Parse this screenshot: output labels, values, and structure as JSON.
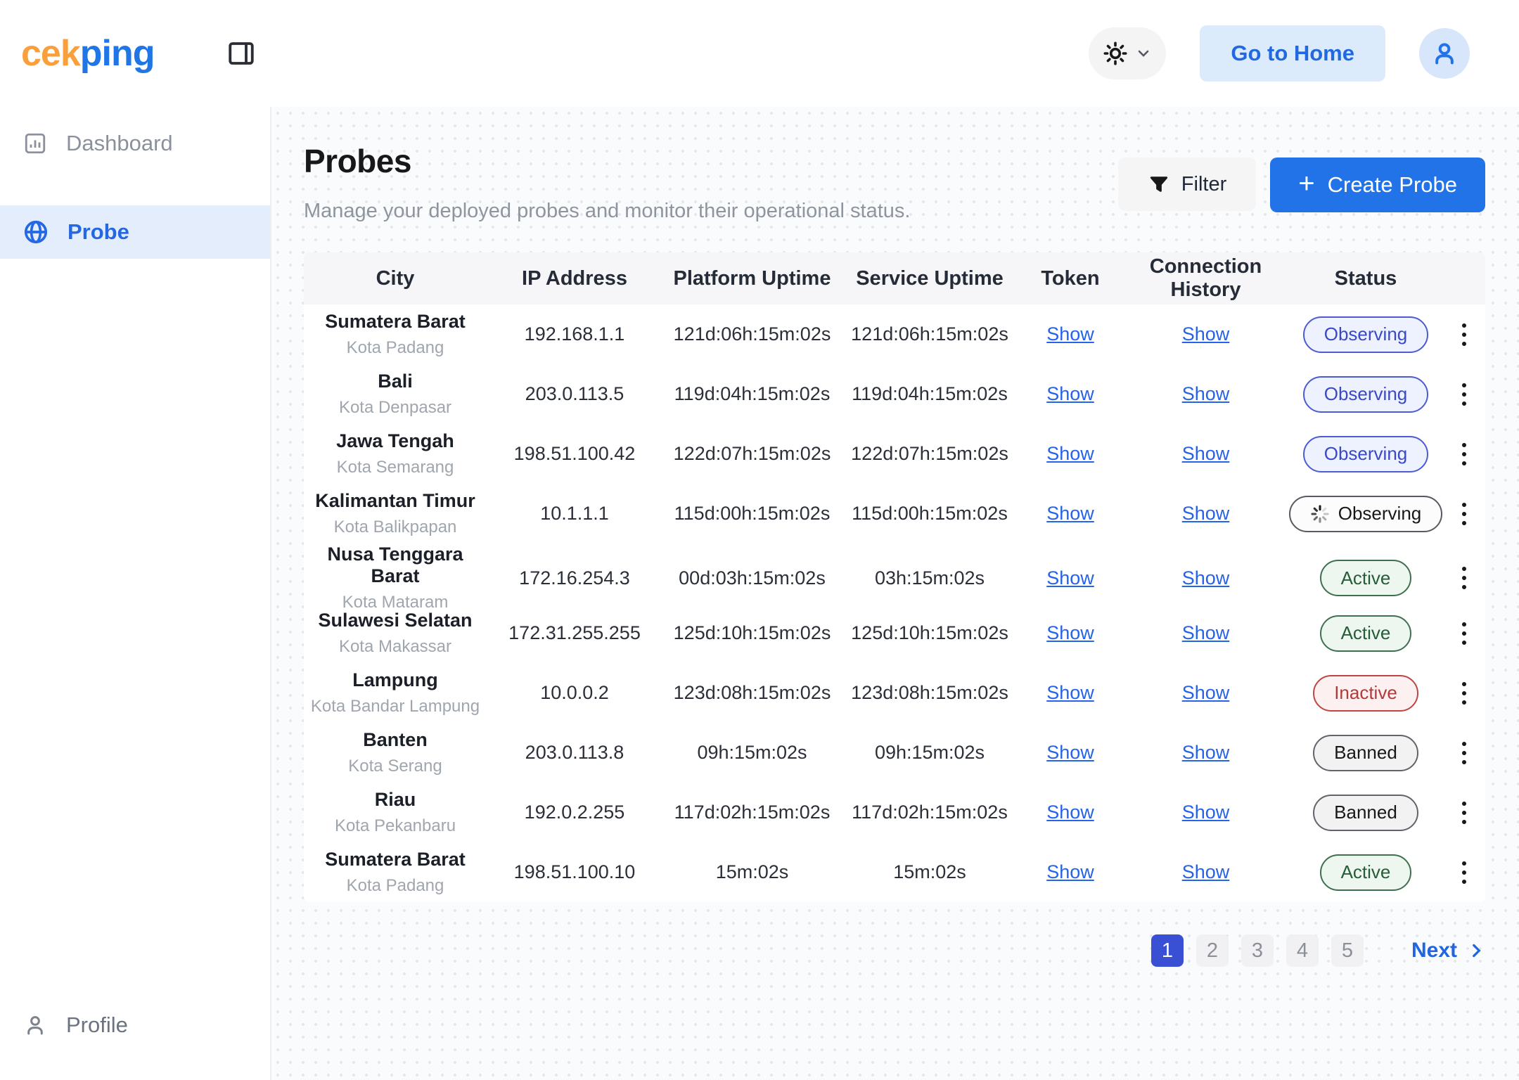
{
  "brand": {
    "part1": "cek",
    "part2": "ping"
  },
  "topbar": {
    "go_home_label": "Go to Home",
    "theme_icon": "sun-icon",
    "avatar_icon": "user-icon",
    "panel_icon": "panel-right-icon"
  },
  "sidebar": {
    "items": [
      {
        "label": "Dashboard",
        "icon": "bar-chart-icon",
        "active": false
      },
      {
        "label": "Probe",
        "icon": "globe-icon",
        "active": true
      },
      {
        "label": "Profile",
        "icon": "user-icon",
        "active": false
      }
    ]
  },
  "page": {
    "title": "Probes",
    "subtitle": "Manage your deployed probes and monitor their operational status.",
    "filter_label": "Filter",
    "create_label": "Create Probe"
  },
  "table": {
    "columns": [
      "City",
      "IP Address",
      "Platform Uptime",
      "Service Uptime",
      "Token",
      "Connection History",
      "Status"
    ],
    "show_label": "Show",
    "rows": [
      {
        "region": "Sumatera Barat",
        "city": "Kota Padang",
        "ip": "192.168.1.1",
        "platform_uptime": "121d:06h:15m:02s",
        "service_uptime": "121d:06h:15m:02s",
        "status": {
          "label": "Observing",
          "variant": "observing",
          "spinner": false
        }
      },
      {
        "region": "Bali",
        "city": "Kota Denpasar",
        "ip": "203.0.113.5",
        "platform_uptime": "119d:04h:15m:02s",
        "service_uptime": "119d:04h:15m:02s",
        "status": {
          "label": "Observing",
          "variant": "observing",
          "spinner": false
        }
      },
      {
        "region": "Jawa Tengah",
        "city": "Kota Semarang",
        "ip": "198.51.100.42",
        "platform_uptime": "122d:07h:15m:02s",
        "service_uptime": "122d:07h:15m:02s",
        "status": {
          "label": "Observing",
          "variant": "observing",
          "spinner": false
        }
      },
      {
        "region": "Kalimantan Timur",
        "city": "Kota Balikpapan",
        "ip": "10.1.1.1",
        "platform_uptime": "115d:00h:15m:02s",
        "service_uptime": "115d:00h:15m:02s",
        "status": {
          "label": "Observing",
          "variant": "observing-loading",
          "spinner": true
        }
      },
      {
        "region": "Nusa Tenggara Barat",
        "city": "Kota Mataram",
        "ip": "172.16.254.3",
        "platform_uptime": "00d:03h:15m:02s",
        "service_uptime": "03h:15m:02s",
        "status": {
          "label": "Active",
          "variant": "active",
          "spinner": false
        }
      },
      {
        "region": "Sulawesi Selatan",
        "city": "Kota Makassar",
        "ip": "172.31.255.255",
        "platform_uptime": "125d:10h:15m:02s",
        "service_uptime": "125d:10h:15m:02s",
        "status": {
          "label": "Active",
          "variant": "active",
          "spinner": false
        }
      },
      {
        "region": "Lampung",
        "city": "Kota Bandar Lampung",
        "ip": "10.0.0.2",
        "platform_uptime": "123d:08h:15m:02s",
        "service_uptime": "123d:08h:15m:02s",
        "status": {
          "label": "Inactive",
          "variant": "inactive",
          "spinner": false
        }
      },
      {
        "region": "Banten",
        "city": "Kota Serang",
        "ip": "203.0.113.8",
        "platform_uptime": "09h:15m:02s",
        "service_uptime": "09h:15m:02s",
        "status": {
          "label": "Banned",
          "variant": "banned",
          "spinner": false
        }
      },
      {
        "region": "Riau",
        "city": "Kota Pekanbaru",
        "ip": "192.0.2.255",
        "platform_uptime": "117d:02h:15m:02s",
        "service_uptime": "117d:02h:15m:02s",
        "status": {
          "label": "Banned",
          "variant": "banned",
          "spinner": false
        }
      },
      {
        "region": "Sumatera Barat",
        "city": "Kota Padang",
        "ip": "198.51.100.10",
        "platform_uptime": "15m:02s",
        "service_uptime": "15m:02s",
        "status": {
          "label": "Active",
          "variant": "active",
          "spinner": false
        }
      }
    ]
  },
  "pagination": {
    "pages": [
      "1",
      "2",
      "3",
      "4",
      "5"
    ],
    "current": "1",
    "next_label": "Next"
  },
  "colors": {
    "brand_orange": "#f9a03c",
    "brand_blue": "#2176e6",
    "accent_blue": "#2273e8",
    "active_item_bg": "#e4edfb",
    "observing_badge": "#3a49c4",
    "active_badge": "#275c38",
    "inactive_badge": "#b23a3a",
    "banned_badge": "#17181a",
    "pagination_active": "#3a50d4"
  }
}
